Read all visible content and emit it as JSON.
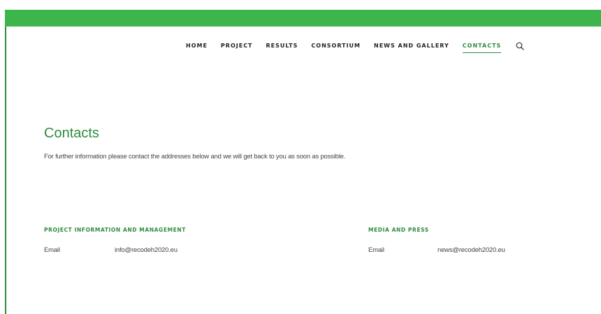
{
  "nav": {
    "items": [
      {
        "label": "HOME"
      },
      {
        "label": "PROJECT"
      },
      {
        "label": "RESULTS"
      },
      {
        "label": "CONSORTIUM"
      },
      {
        "label": "NEWS AND GALLERY"
      },
      {
        "label": "CONTACTS",
        "active": true
      }
    ],
    "search_icon": "search-icon"
  },
  "colors": {
    "top_bar": "#3cb54a",
    "accent": "#2e8b3e",
    "nav_text": "#222222",
    "body_text": "#444444"
  },
  "page": {
    "title": "Contacts",
    "intro": "For further information please contact the addresses below and we will get back to you as soon as possible."
  },
  "sections": [
    {
      "title": "PROJECT INFORMATION AND MANAGEMENT",
      "label": "Email",
      "value": "info@recodeh2020.eu"
    },
    {
      "title": "MEDIA AND PRESS",
      "label": "Email",
      "value": "news@recodeh2020.eu"
    }
  ]
}
